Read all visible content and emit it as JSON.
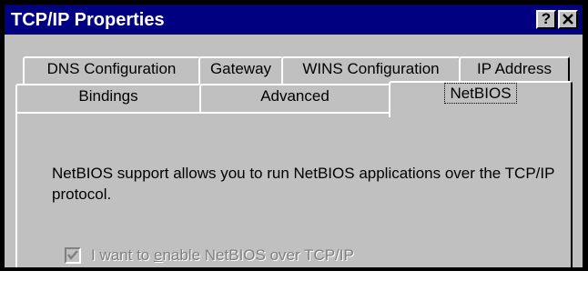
{
  "window": {
    "title": "TCP/IP Properties",
    "help_button": "?",
    "close_button": "×"
  },
  "tabs": {
    "row1": [
      {
        "label": "DNS Configuration"
      },
      {
        "label": "Gateway"
      },
      {
        "label": "WINS Configuration"
      },
      {
        "label": "IP Address"
      }
    ],
    "row2": [
      {
        "label": "Bindings"
      },
      {
        "label": "Advanced"
      },
      {
        "label": "NetBIOS",
        "selected": true
      }
    ]
  },
  "netbios_panel": {
    "description": "NetBIOS support allows you to run NetBIOS applications over the TCP/IP protocol.",
    "checkbox": {
      "label_prefix": "I want to ",
      "label_mnemonic": "e",
      "label_suffix": "nable NetBIOS over TCP/IP",
      "checked": true,
      "enabled": false
    }
  },
  "colors": {
    "title_bar": "#000080",
    "face": "#c0c0c0",
    "disabled_text": "#808080"
  }
}
